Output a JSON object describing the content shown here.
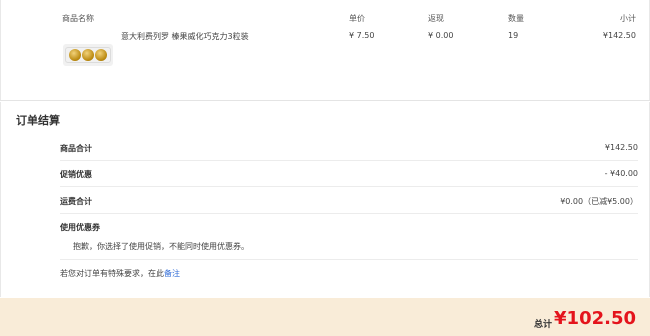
{
  "cart": {
    "headers": {
      "name": "商品名称",
      "price": "单价",
      "rebate": "返现",
      "qty": "数量",
      "subtotal": "小计"
    },
    "item": {
      "title": "意大利费列罗 榛果威化巧克力3粒装",
      "price": "¥ 7.50",
      "rebate": "¥ 0.00",
      "qty": "19",
      "subtotal": "¥142.50",
      "image_icon": "chocolate-box-icon"
    }
  },
  "summary": {
    "title": "订单结算",
    "rows": [
      {
        "label": "商品合计",
        "value": "¥142.50"
      },
      {
        "label": "促销优惠",
        "value": "- ¥40.00"
      },
      {
        "label": "运费合计",
        "value": "¥0.00（已减¥5.00）"
      }
    ],
    "coupon_label": "使用优惠券",
    "coupon_message": "抱歉，你选择了使用促销，不能同时使用优惠券。",
    "remark_text": "若您对订单有特殊要求，在此",
    "remark_link": "备注"
  },
  "footer": {
    "total_label": "总计",
    "total_value": "¥102.50"
  },
  "colors": {
    "accent_red": "#e4141c",
    "link_blue": "#2f6bd6",
    "footer_bg": "#f9ecd8"
  }
}
